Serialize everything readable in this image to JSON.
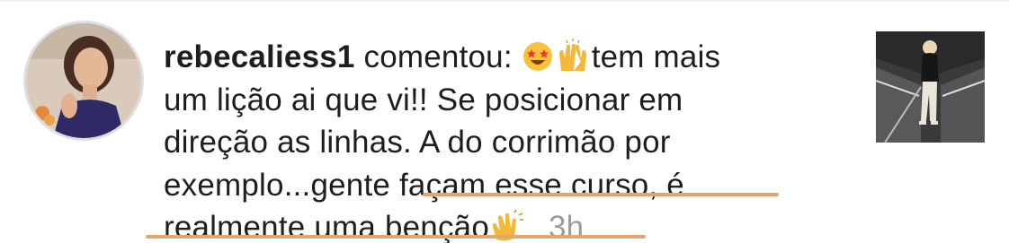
{
  "comment": {
    "username": "rebecaliess1",
    "verb": "comentou:",
    "emojis": [
      "star-struck-emoji",
      "raising-hands-emoji"
    ],
    "lines": [
      "tem mais",
      "um lição ai que vi!! Se posicionar em",
      "direção as linhas. A do corrimão por",
      "exemplo...gente façam esse curso, é",
      "realmente uma benção"
    ],
    "trailing_emoji": "clapping-hands-emoji",
    "time": "3h"
  },
  "colors": {
    "highlight_underline": "#e5a66e",
    "text": "#1e1e1e",
    "time": "#9b9b9b"
  }
}
